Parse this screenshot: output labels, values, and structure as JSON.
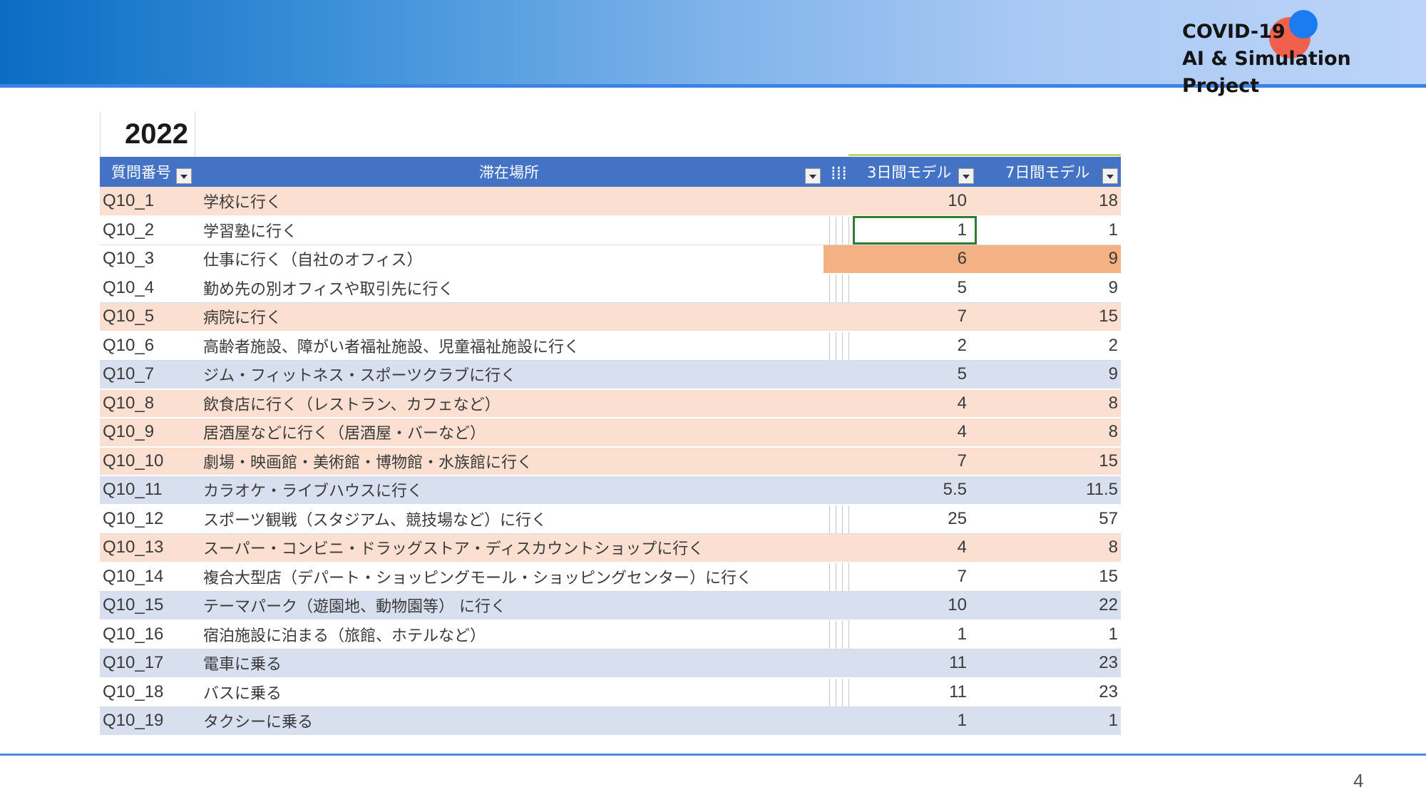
{
  "brand": {
    "line1": "COVID-19",
    "line2": "AI & Simulation Project"
  },
  "sheet": {
    "year": "2022",
    "headers": {
      "question_id": "質問番号",
      "location": "滞在場所",
      "model_3day": "3日間モデル",
      "model_7day": "7日間モデル"
    },
    "rows": [
      {
        "id": "Q10_1",
        "location": "学校に行く",
        "d3": "10",
        "d7": "18",
        "style": "peach"
      },
      {
        "id": "Q10_2",
        "location": "学習塾に行く",
        "d3": "1",
        "d7": "1",
        "style": "white",
        "selected": true
      },
      {
        "id": "Q10_3",
        "location": "仕事に行く（自社のオフィス）",
        "d3": "6",
        "d7": "9",
        "style": "hl"
      },
      {
        "id": "Q10_4",
        "location": "勤め先の別オフィスや取引先に行く",
        "d3": "5",
        "d7": "9",
        "style": "white"
      },
      {
        "id": "Q10_5",
        "location": "病院に行く",
        "d3": "7",
        "d7": "15",
        "style": "peach"
      },
      {
        "id": "Q10_6",
        "location": "高齢者施設、障がい者福祉施設、児童福祉施設に行く",
        "d3": "2",
        "d7": "2",
        "style": "white"
      },
      {
        "id": "Q10_7",
        "location": "ジム・フィットネス・スポーツクラブに行く",
        "d3": "5",
        "d7": "9",
        "style": "blue"
      },
      {
        "id": "Q10_8",
        "location": "飲食店に行く（レストラン、カフェなど）",
        "d3": "4",
        "d7": "8",
        "style": "peach"
      },
      {
        "id": "Q10_9",
        "location": "居酒屋などに行く（居酒屋・バーなど）",
        "d3": "4",
        "d7": "8",
        "style": "peach"
      },
      {
        "id": "Q10_10",
        "location": "劇場・映画館・美術館・博物館・水族館に行く",
        "d3": "7",
        "d7": "15",
        "style": "peach"
      },
      {
        "id": "Q10_11",
        "location": "カラオケ・ライブハウスに行く",
        "d3": "5.5",
        "d7": "11.5",
        "style": "blue"
      },
      {
        "id": "Q10_12",
        "location": "スポーツ観戦（スタジアム、競技場など）に行く",
        "d3": "25",
        "d7": "57",
        "style": "white"
      },
      {
        "id": "Q10_13",
        "location": "スーパー・コンビニ・ドラッグストア・ディスカウントショップに行く",
        "d3": "4",
        "d7": "8",
        "style": "peach"
      },
      {
        "id": "Q10_14",
        "location": "複合大型店（デパート・ショッピングモール・ショッピングセンター）に行く",
        "d3": "7",
        "d7": "15",
        "style": "white"
      },
      {
        "id": "Q10_15",
        "location": "テーマパーク（遊園地、動物園等） に行く",
        "d3": "10",
        "d7": "22",
        "style": "blue"
      },
      {
        "id": "Q10_16",
        "location": "宿泊施設に泊まる（旅館、ホテルなど）",
        "d3": "1",
        "d7": "1",
        "style": "white"
      },
      {
        "id": "Q10_17",
        "location": "電車に乗る",
        "d3": "11",
        "d7": "23",
        "style": "blue"
      },
      {
        "id": "Q10_18",
        "location": "バスに乗る",
        "d3": "11",
        "d7": "23",
        "style": "white"
      },
      {
        "id": "Q10_19",
        "location": "タクシーに乗る",
        "d3": "1",
        "d7": "1",
        "style": "blue"
      }
    ]
  },
  "colors": {
    "header_blue": "#4472c4",
    "row_peach": "#fbe0d2",
    "row_blue": "#d8e0f0",
    "highlight_orange": "#f4b183",
    "selection_green": "#2e7d32"
  },
  "footer": {
    "page_number": "4"
  }
}
